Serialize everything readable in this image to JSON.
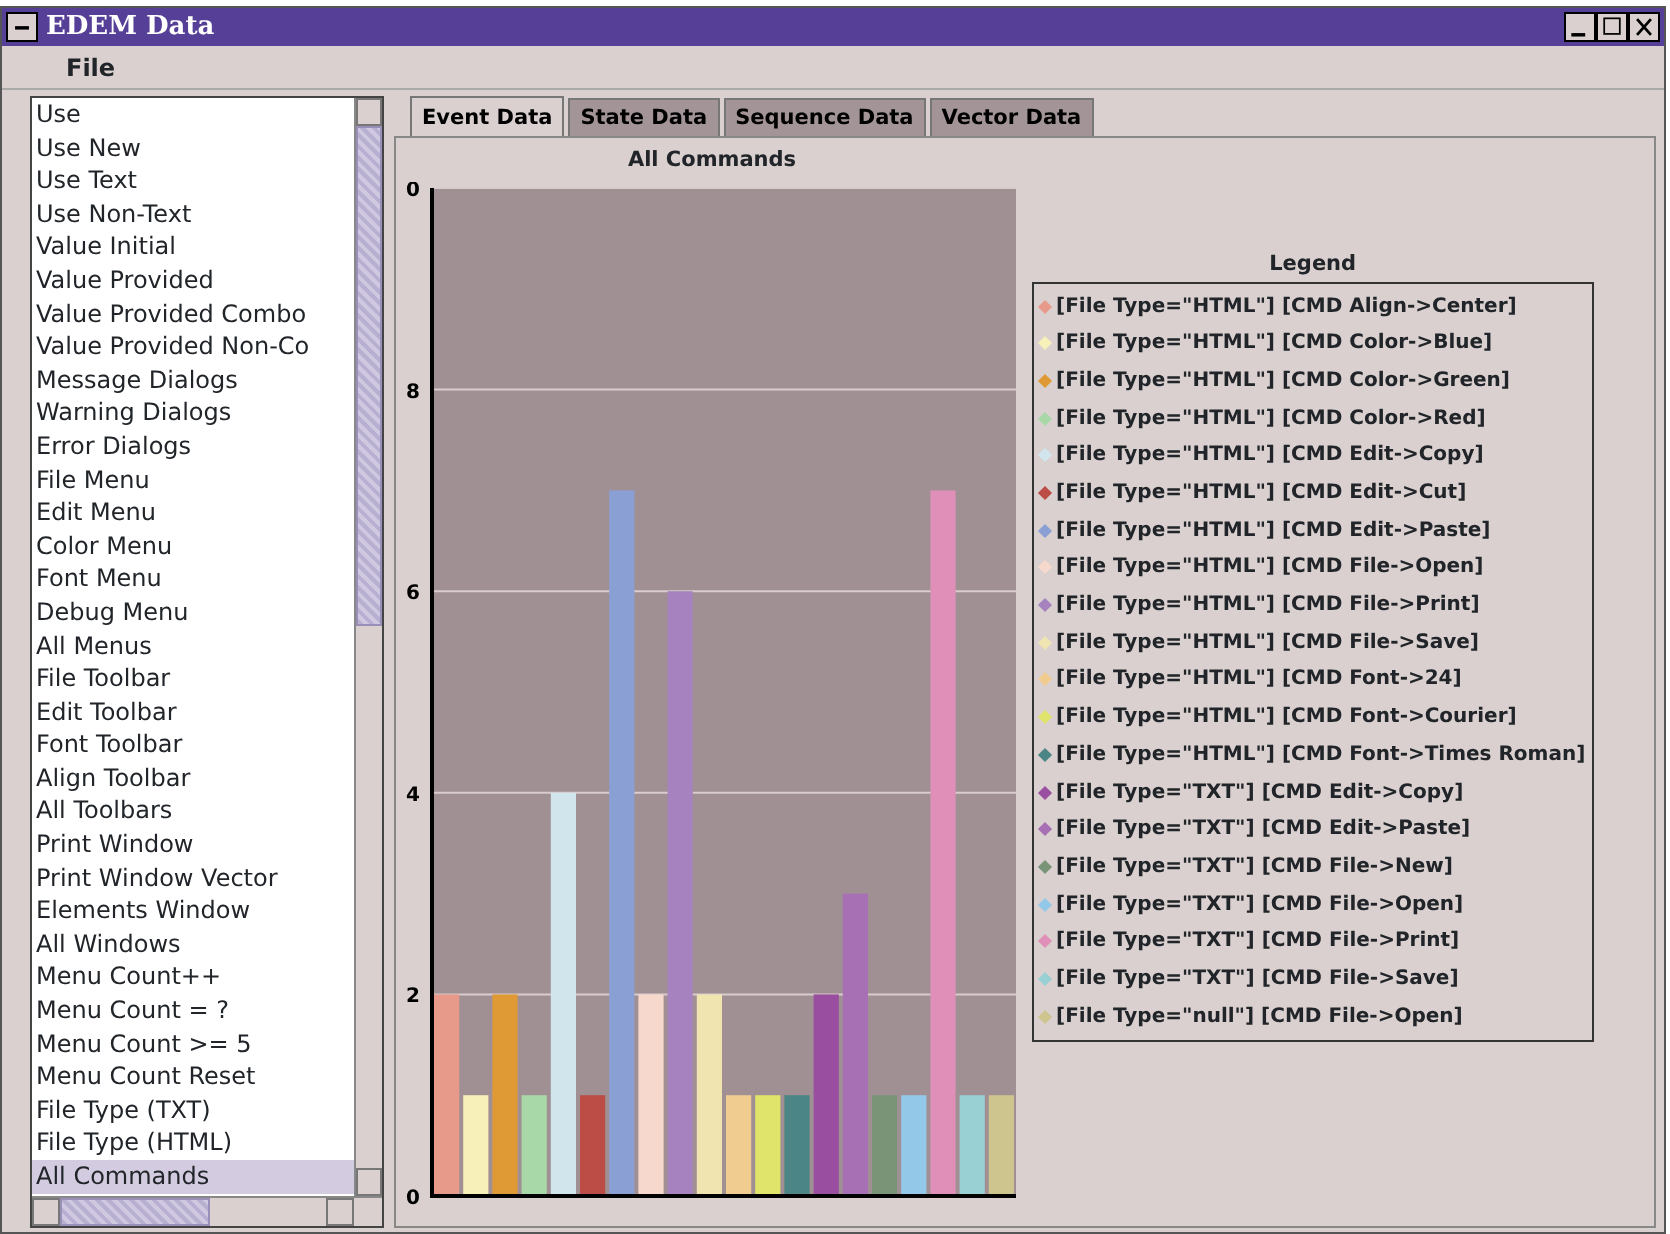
{
  "window": {
    "title": "EDEM Data"
  },
  "menu": [
    "File"
  ],
  "list": {
    "items": [
      {
        "label": "Use",
        "selected": false
      },
      {
        "label": "Use New",
        "selected": false
      },
      {
        "label": "Use Text",
        "selected": false
      },
      {
        "label": "Use Non-Text",
        "selected": false
      },
      {
        "label": "Value Initial",
        "selected": false
      },
      {
        "label": "Value Provided",
        "selected": false
      },
      {
        "label": "Value Provided Combo",
        "selected": false
      },
      {
        "label": "Value Provided Non-Co",
        "selected": false
      },
      {
        "label": "Message Dialogs",
        "selected": false
      },
      {
        "label": "Warning Dialogs",
        "selected": false
      },
      {
        "label": "Error Dialogs",
        "selected": false
      },
      {
        "label": "File Menu",
        "selected": false
      },
      {
        "label": "Edit Menu",
        "selected": false
      },
      {
        "label": "Color Menu",
        "selected": false
      },
      {
        "label": "Font Menu",
        "selected": false
      },
      {
        "label": "Debug Menu",
        "selected": false
      },
      {
        "label": "All Menus",
        "selected": false
      },
      {
        "label": "File Toolbar",
        "selected": false
      },
      {
        "label": "Edit Toolbar",
        "selected": false
      },
      {
        "label": "Font Toolbar",
        "selected": false
      },
      {
        "label": "Align Toolbar",
        "selected": false
      },
      {
        "label": "All Toolbars",
        "selected": false
      },
      {
        "label": "Print Window",
        "selected": false
      },
      {
        "label": "Print Window Vector",
        "selected": false
      },
      {
        "label": "Elements Window",
        "selected": false
      },
      {
        "label": "All Windows",
        "selected": false
      },
      {
        "label": "Menu Count++",
        "selected": false
      },
      {
        "label": "Menu Count = ?",
        "selected": false
      },
      {
        "label": "Menu Count >= 5",
        "selected": false
      },
      {
        "label": "Menu Count Reset",
        "selected": false
      },
      {
        "label": "File Type (TXT)",
        "selected": false
      },
      {
        "label": "File Type (HTML)",
        "selected": false
      },
      {
        "label": "All Commands",
        "selected": true
      }
    ]
  },
  "tabs": [
    {
      "label": "Event Data",
      "selected": true
    },
    {
      "label": "State Data",
      "selected": false
    },
    {
      "label": "Sequence Data",
      "selected": false
    },
    {
      "label": "Vector Data",
      "selected": false
    }
  ],
  "chart": {
    "top_tick_label": "0",
    "chart_data": {
      "type": "bar",
      "title": "All Commands",
      "ylim": [
        0,
        10
      ],
      "grid": true,
      "legend": {
        "title": "Legend"
      },
      "yticks": [
        0,
        2,
        4,
        6,
        8
      ],
      "series": [
        {
          "name": "[File Type=\"HTML\"] [CMD Align->Center]",
          "color": "#e89a8a",
          "values": [
            2
          ]
        },
        {
          "name": "[File Type=\"HTML\"] [CMD Color->Blue]",
          "color": "#f7f0b8",
          "values": [
            1
          ]
        },
        {
          "name": "[File Type=\"HTML\"] [CMD Color->Green]",
          "color": "#e09a35",
          "values": [
            2
          ]
        },
        {
          "name": "[File Type=\"HTML\"] [CMD Color->Red]",
          "color": "#a8d8a8",
          "values": [
            1
          ]
        },
        {
          "name": "[File Type=\"HTML\"] [CMD Edit->Copy]",
          "color": "#d0e6ec",
          "values": [
            4
          ]
        },
        {
          "name": "[File Type=\"HTML\"] [CMD Edit->Cut]",
          "color": "#bb4c46",
          "values": [
            1
          ]
        },
        {
          "name": "[File Type=\"HTML\"] [CMD Edit->Paste]",
          "color": "#8aa0d4",
          "values": [
            7
          ]
        },
        {
          "name": "[File Type=\"HTML\"] [CMD File->Open]",
          "color": "#f7d8cc",
          "values": [
            2
          ]
        },
        {
          "name": "[File Type=\"HTML\"] [CMD File->Print]",
          "color": "#a683bf",
          "values": [
            6
          ]
        },
        {
          "name": "[File Type=\"HTML\"] [CMD File->Save]",
          "color": "#f0e4b0",
          "values": [
            2
          ]
        },
        {
          "name": "[File Type=\"HTML\"] [CMD Font->24]",
          "color": "#f0cc90",
          "values": [
            1
          ]
        },
        {
          "name": "[File Type=\"HTML\"] [CMD Font->Courier]",
          "color": "#e0e46a",
          "values": [
            1
          ]
        },
        {
          "name": "[File Type=\"HTML\"] [CMD Font->Times Roman]",
          "color": "#4b8585",
          "values": [
            1
          ]
        },
        {
          "name": "[File Type=\"TXT\"] [CMD Edit->Copy]",
          "color": "#9a4ea0",
          "values": [
            2
          ]
        },
        {
          "name": "[File Type=\"TXT\"] [CMD Edit->Paste]",
          "color": "#a870b4",
          "values": [
            3
          ]
        },
        {
          "name": "[File Type=\"TXT\"] [CMD File->New]",
          "color": "#7a9478",
          "values": [
            1
          ]
        },
        {
          "name": "[File Type=\"TXT\"] [CMD File->Open]",
          "color": "#94c8e8",
          "values": [
            1
          ]
        },
        {
          "name": "[File Type=\"TXT\"] [CMD File->Print]",
          "color": "#e090b8",
          "values": [
            7
          ]
        },
        {
          "name": "[File Type=\"TXT\"] [CMD File->Save]",
          "color": "#98d0d4",
          "values": [
            1
          ]
        },
        {
          "name": "[File Type=\"null\"] [CMD File->Open]",
          "color": "#cec48e",
          "values": [
            1
          ]
        }
      ]
    }
  }
}
